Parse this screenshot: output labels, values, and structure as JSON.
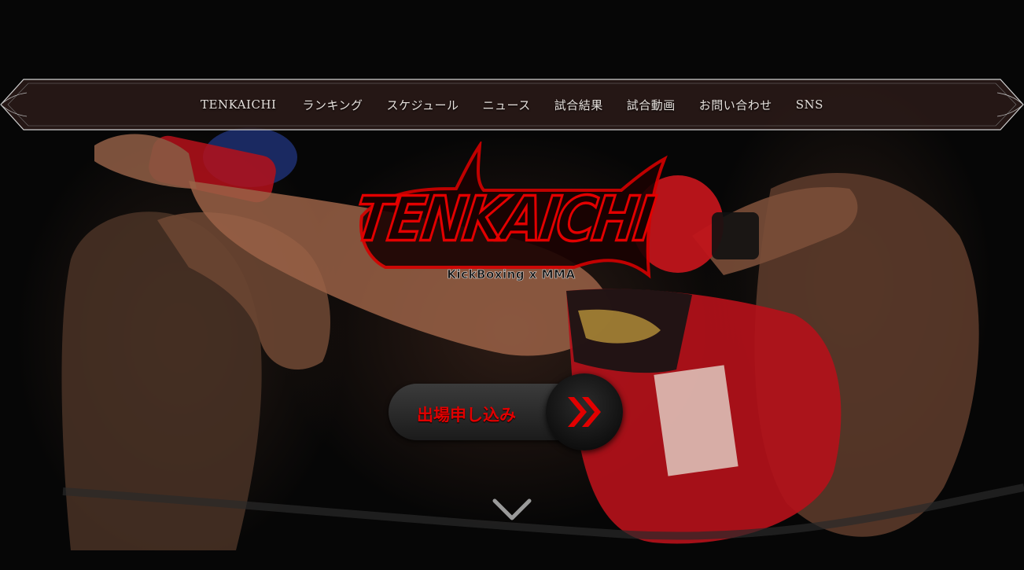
{
  "nav": {
    "items": [
      {
        "label": "TENKAICHI"
      },
      {
        "label": "ランキング"
      },
      {
        "label": "スケジュール"
      },
      {
        "label": "ニュース"
      },
      {
        "label": "試合結果"
      },
      {
        "label": "試合動画"
      },
      {
        "label": "お問い合わせ"
      },
      {
        "label": "SNS"
      }
    ]
  },
  "logo": {
    "title": "TENKAICHI",
    "subtitle": "KickBoxing x MMA"
  },
  "cta": {
    "label": "出場申し込み",
    "arrow_icon": "double-chevron-right-icon"
  },
  "scroll": {
    "icon": "chevron-down-icon"
  },
  "colors": {
    "accent": "#e30000",
    "nav_bg": "#2a1c1a",
    "nav_border": "#c8c8c8",
    "background": "#050505"
  }
}
